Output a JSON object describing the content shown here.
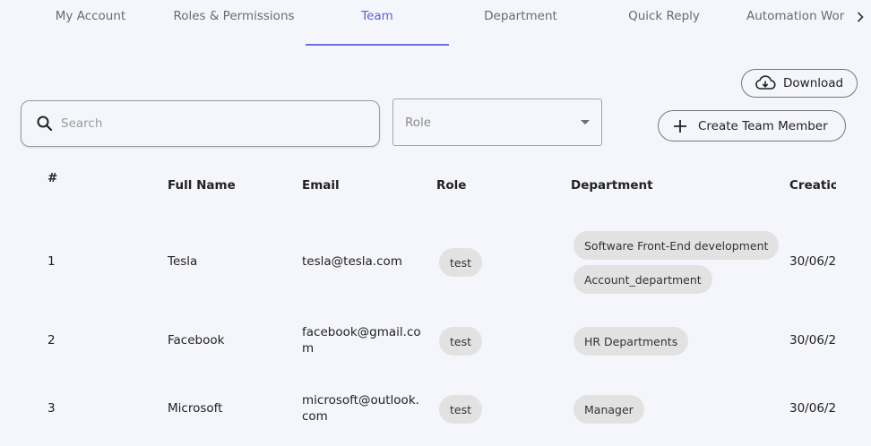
{
  "tabs": [
    {
      "label": "My Account"
    },
    {
      "label": "Roles & Permissions"
    },
    {
      "label": "Team"
    },
    {
      "label": "Department"
    },
    {
      "label": "Quick Reply"
    },
    {
      "label": "Automation Wor"
    }
  ],
  "active_tab": "Team",
  "accent_color": "#5b61d6",
  "toolbar": {
    "download_label": "Download",
    "create_label": "Create Team Member"
  },
  "search": {
    "placeholder": "Search",
    "value": ""
  },
  "role_filter": {
    "placeholder": "Role"
  },
  "table": {
    "headers": [
      "#",
      "Full Name",
      "Email",
      "Role",
      "Department",
      "Creation"
    ],
    "rows": [
      {
        "index": "1",
        "name": "Tesla",
        "email": "tesla@tesla.com",
        "role": "test",
        "departments": [
          "Software Front-End development",
          "Account_department"
        ],
        "creation": "30/06/2"
      },
      {
        "index": "2",
        "name": "Facebook",
        "email": "facebook@gmail.com",
        "role": "test",
        "departments": [
          "HR Departments"
        ],
        "creation": "30/06/2"
      },
      {
        "index": "3",
        "name": "Microsoft",
        "email": "microsoft@outlook.com",
        "role": "test",
        "departments": [
          "Manager"
        ],
        "creation": "30/06/2"
      }
    ]
  }
}
